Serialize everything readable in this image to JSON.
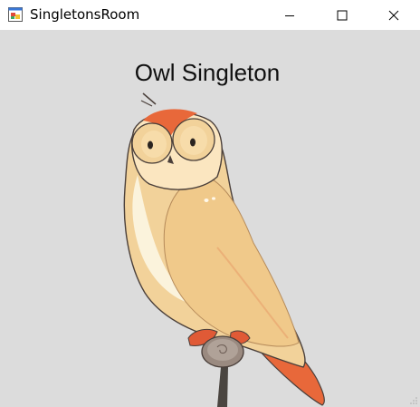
{
  "window": {
    "title": "SingletonsRoom",
    "icon": "winforms-app-icon",
    "controls": {
      "minimize": "minimize-icon",
      "maximize": "maximize-icon",
      "close": "close-icon"
    }
  },
  "form": {
    "label": "Owl Singleton",
    "background": "#dcdcdc",
    "picture": "owl-illustration"
  },
  "colors": {
    "owl_body": "#f2d29a",
    "owl_belly": "#fbf3dc",
    "owl_orange": "#e8683a",
    "owl_outline": "#4a3f3a",
    "perch": "#8a7a70"
  }
}
